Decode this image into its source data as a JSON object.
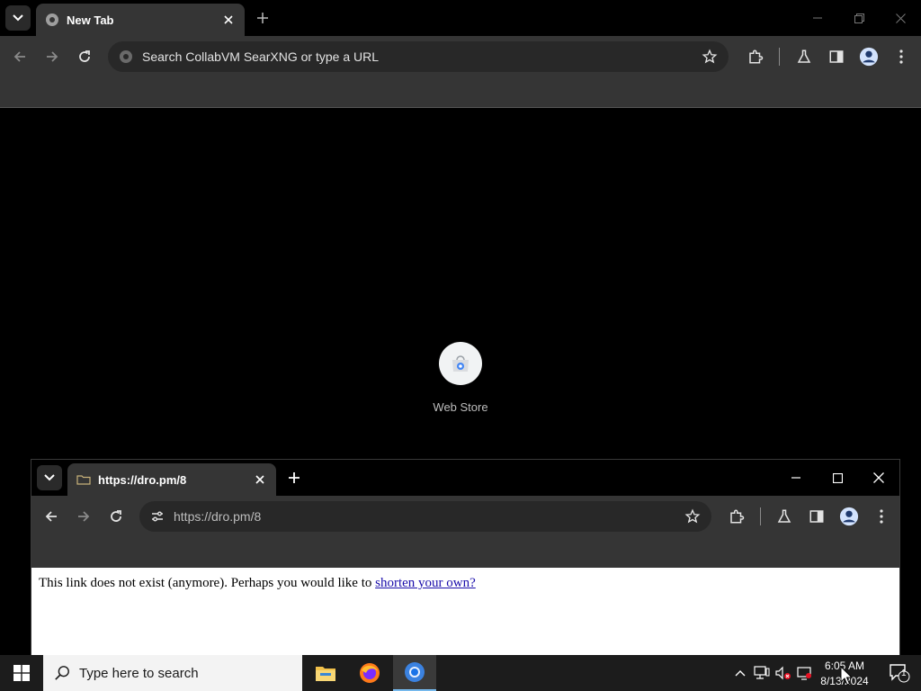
{
  "main_window": {
    "tab": {
      "title": "New Tab"
    },
    "omnibox": {
      "placeholder": "Search CollabVM SearXNG or type a URL"
    },
    "ntp": {
      "tile_label": "Web Store"
    }
  },
  "popup_window": {
    "tab": {
      "title": "https://dro.pm/8"
    },
    "omnibox": {
      "url": "https://dro.pm/8"
    },
    "content": {
      "message": "This link does not exist (anymore). Perhaps you would like to ",
      "link_text": "shorten your own?"
    }
  },
  "taskbar": {
    "search_placeholder": "Type here to search",
    "apps": [
      "file-explorer",
      "firefox",
      "chrome"
    ],
    "clock": {
      "time": "6:05 AM",
      "date": "8/13/2024"
    },
    "notification_count": "1"
  },
  "colors": {
    "chrome_toolbar": "#353535",
    "omnibox": "#282828",
    "link": "#1a0dab",
    "taskbar": "#1c1c1c",
    "taskbar_active": "#76b9ed"
  }
}
